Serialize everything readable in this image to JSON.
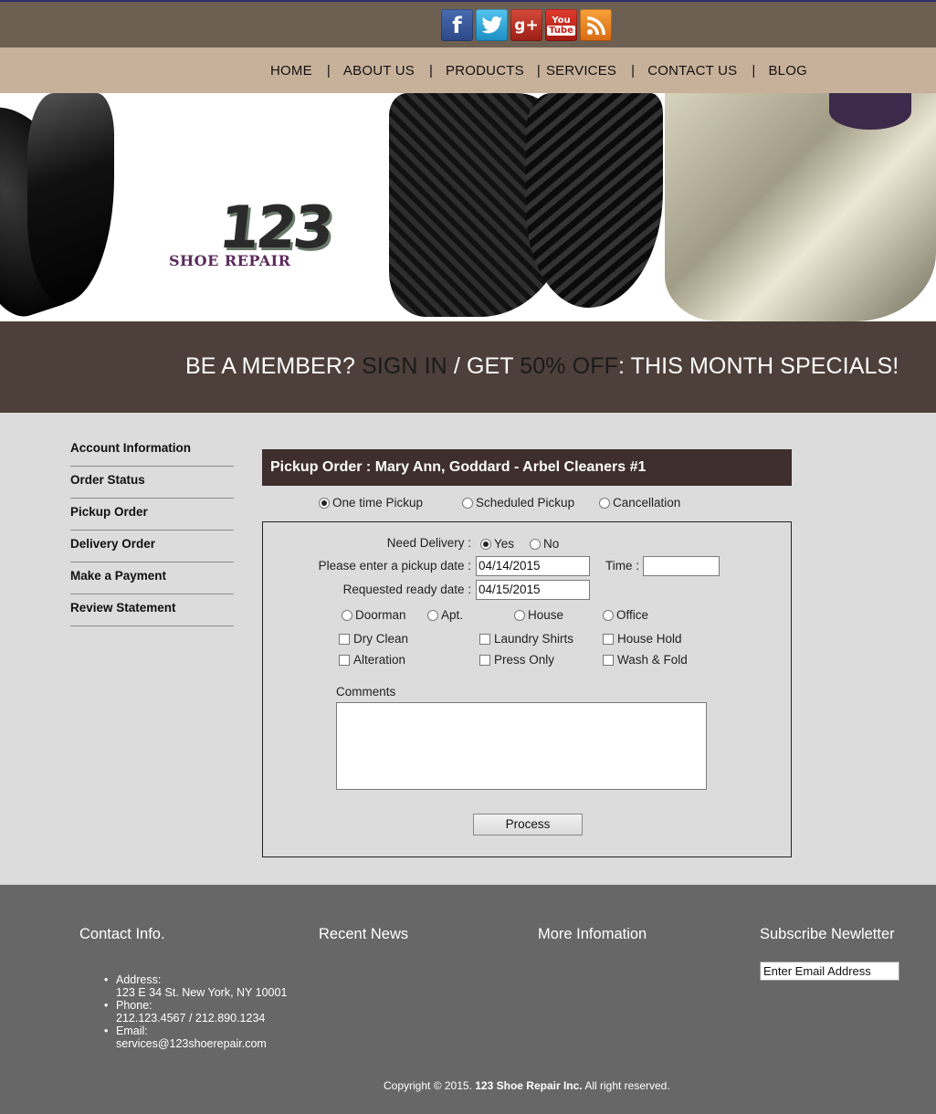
{
  "social": [
    "facebook-icon",
    "twitter-icon",
    "google-plus-icon",
    "youtube-icon",
    "rss-icon"
  ],
  "nav": {
    "items": [
      "HOME",
      "ABOUT US",
      "PRODUCTS",
      "SERVICES",
      "CONTACT US",
      "BLOG"
    ],
    "separator": "|"
  },
  "logo": {
    "number": "123",
    "text": "SHOE REPAIR"
  },
  "promo": {
    "part1": "BE A MEMBER? ",
    "sign_in": "SIGN IN",
    "part2": " / GET ",
    "discount": "50% OFF",
    "part3": ": THIS MONTH SPECIALS!"
  },
  "sidebar": {
    "items": [
      "Account Information",
      "Order Status",
      "Pickup Order",
      "Delivery Order",
      "Make a Payment",
      "Review Statement"
    ]
  },
  "panel": {
    "title": "Pickup Order : Mary Ann, Goddard - Arbel Cleaners #1",
    "types": [
      {
        "label": "One time Pickup",
        "selected": true
      },
      {
        "label": "Scheduled Pickup",
        "selected": false
      },
      {
        "label": "Cancellation",
        "selected": false
      }
    ]
  },
  "form": {
    "need_delivery_label": "Need Delivery :",
    "yes_label": "Yes",
    "no_label": "No",
    "pickup_date_label": "Please enter a pickup date :",
    "pickup_date_value": "04/14/2015",
    "time_label": "Time :",
    "time_value": "",
    "ready_date_label": "Requested ready date :",
    "ready_date_value": "04/15/2015",
    "locations": [
      "Doorman",
      "Apt.",
      "House",
      "Office"
    ],
    "services_row1": [
      "Dry Clean",
      "Laundry Shirts",
      "House Hold"
    ],
    "services_row2": [
      "Alteration",
      "Press Only",
      "Wash & Fold"
    ],
    "comments_label": "Comments",
    "comments_value": "",
    "process_label": "Process"
  },
  "footer": {
    "contact_heading": "Contact Info.",
    "news_heading": "Recent News",
    "more_heading": "More Infomation",
    "subscribe_heading": "Subscribe Newletter",
    "email_placeholder": "Enter Email Address",
    "address_label": "Address:",
    "address_value": "123 E 34 St. New York, NY 10001",
    "phone_label": "Phone:",
    "phone_value": "212.123.4567 / 212.890.1234",
    "email_label": "Email:",
    "email_value": "services@123shoerepair.com",
    "copyright_prefix": "Copyright © 2015.",
    "copyright_company": "123 Shoe Repair Inc.",
    "copyright_suffix": "All right reserved."
  }
}
